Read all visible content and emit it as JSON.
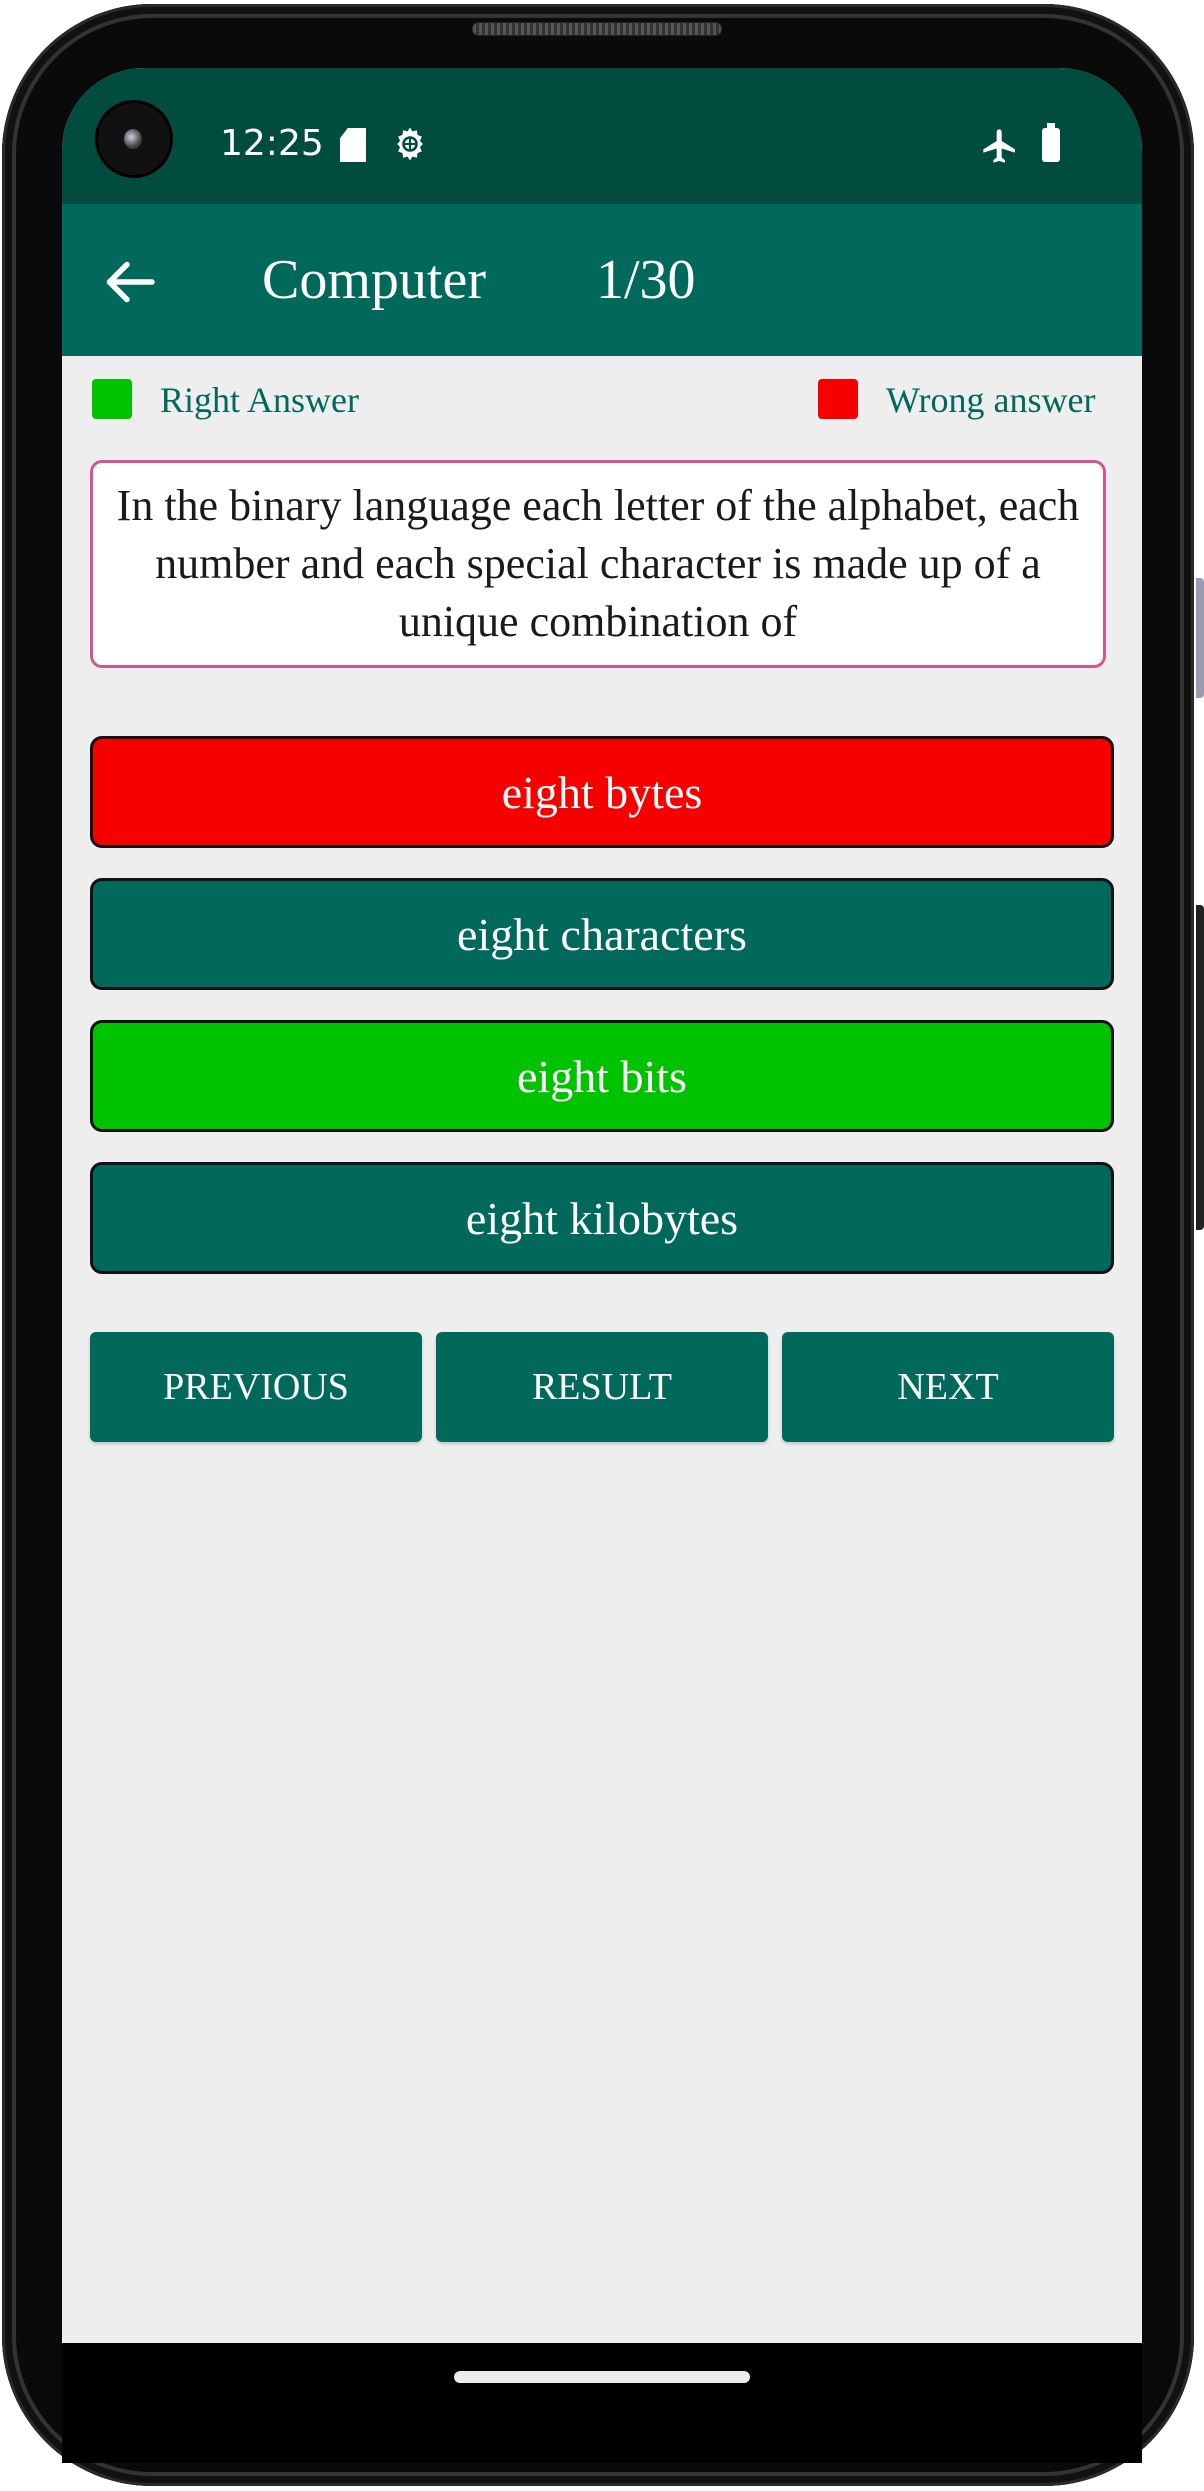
{
  "status_bar": {
    "time": "12:25",
    "left_icons": [
      "sd-card-icon",
      "settings-gear-icon"
    ],
    "right_icons": [
      "airplane-mode-icon",
      "battery-icon"
    ]
  },
  "app_bar": {
    "back_icon": "arrow-left-icon",
    "title": "Computer",
    "question_counter": "1/30"
  },
  "legend": {
    "right_label": "Right Answer",
    "right_color": "#00c300",
    "wrong_label": "Wrong answer",
    "wrong_color": "#f70000"
  },
  "question": {
    "text": "In the binary language each letter of the alphabet, each number and each special character is made up of a unique combination of"
  },
  "options": [
    {
      "label": "eight bytes",
      "state": "wrong",
      "color": "#f70000"
    },
    {
      "label": "eight characters",
      "state": "neutral",
      "color": "#00695c"
    },
    {
      "label": "eight bits",
      "state": "correct",
      "color": "#00c300"
    },
    {
      "label": "eight kilobytes",
      "state": "neutral",
      "color": "#00695c"
    }
  ],
  "navigation": {
    "previous_label": "PREVIOUS",
    "result_label": "RESULT",
    "next_label": "NEXT"
  },
  "theme": {
    "primary": "#00695c",
    "primary_dark": "#004d40",
    "question_border": "#d6558f",
    "background": "#eeeeee"
  }
}
